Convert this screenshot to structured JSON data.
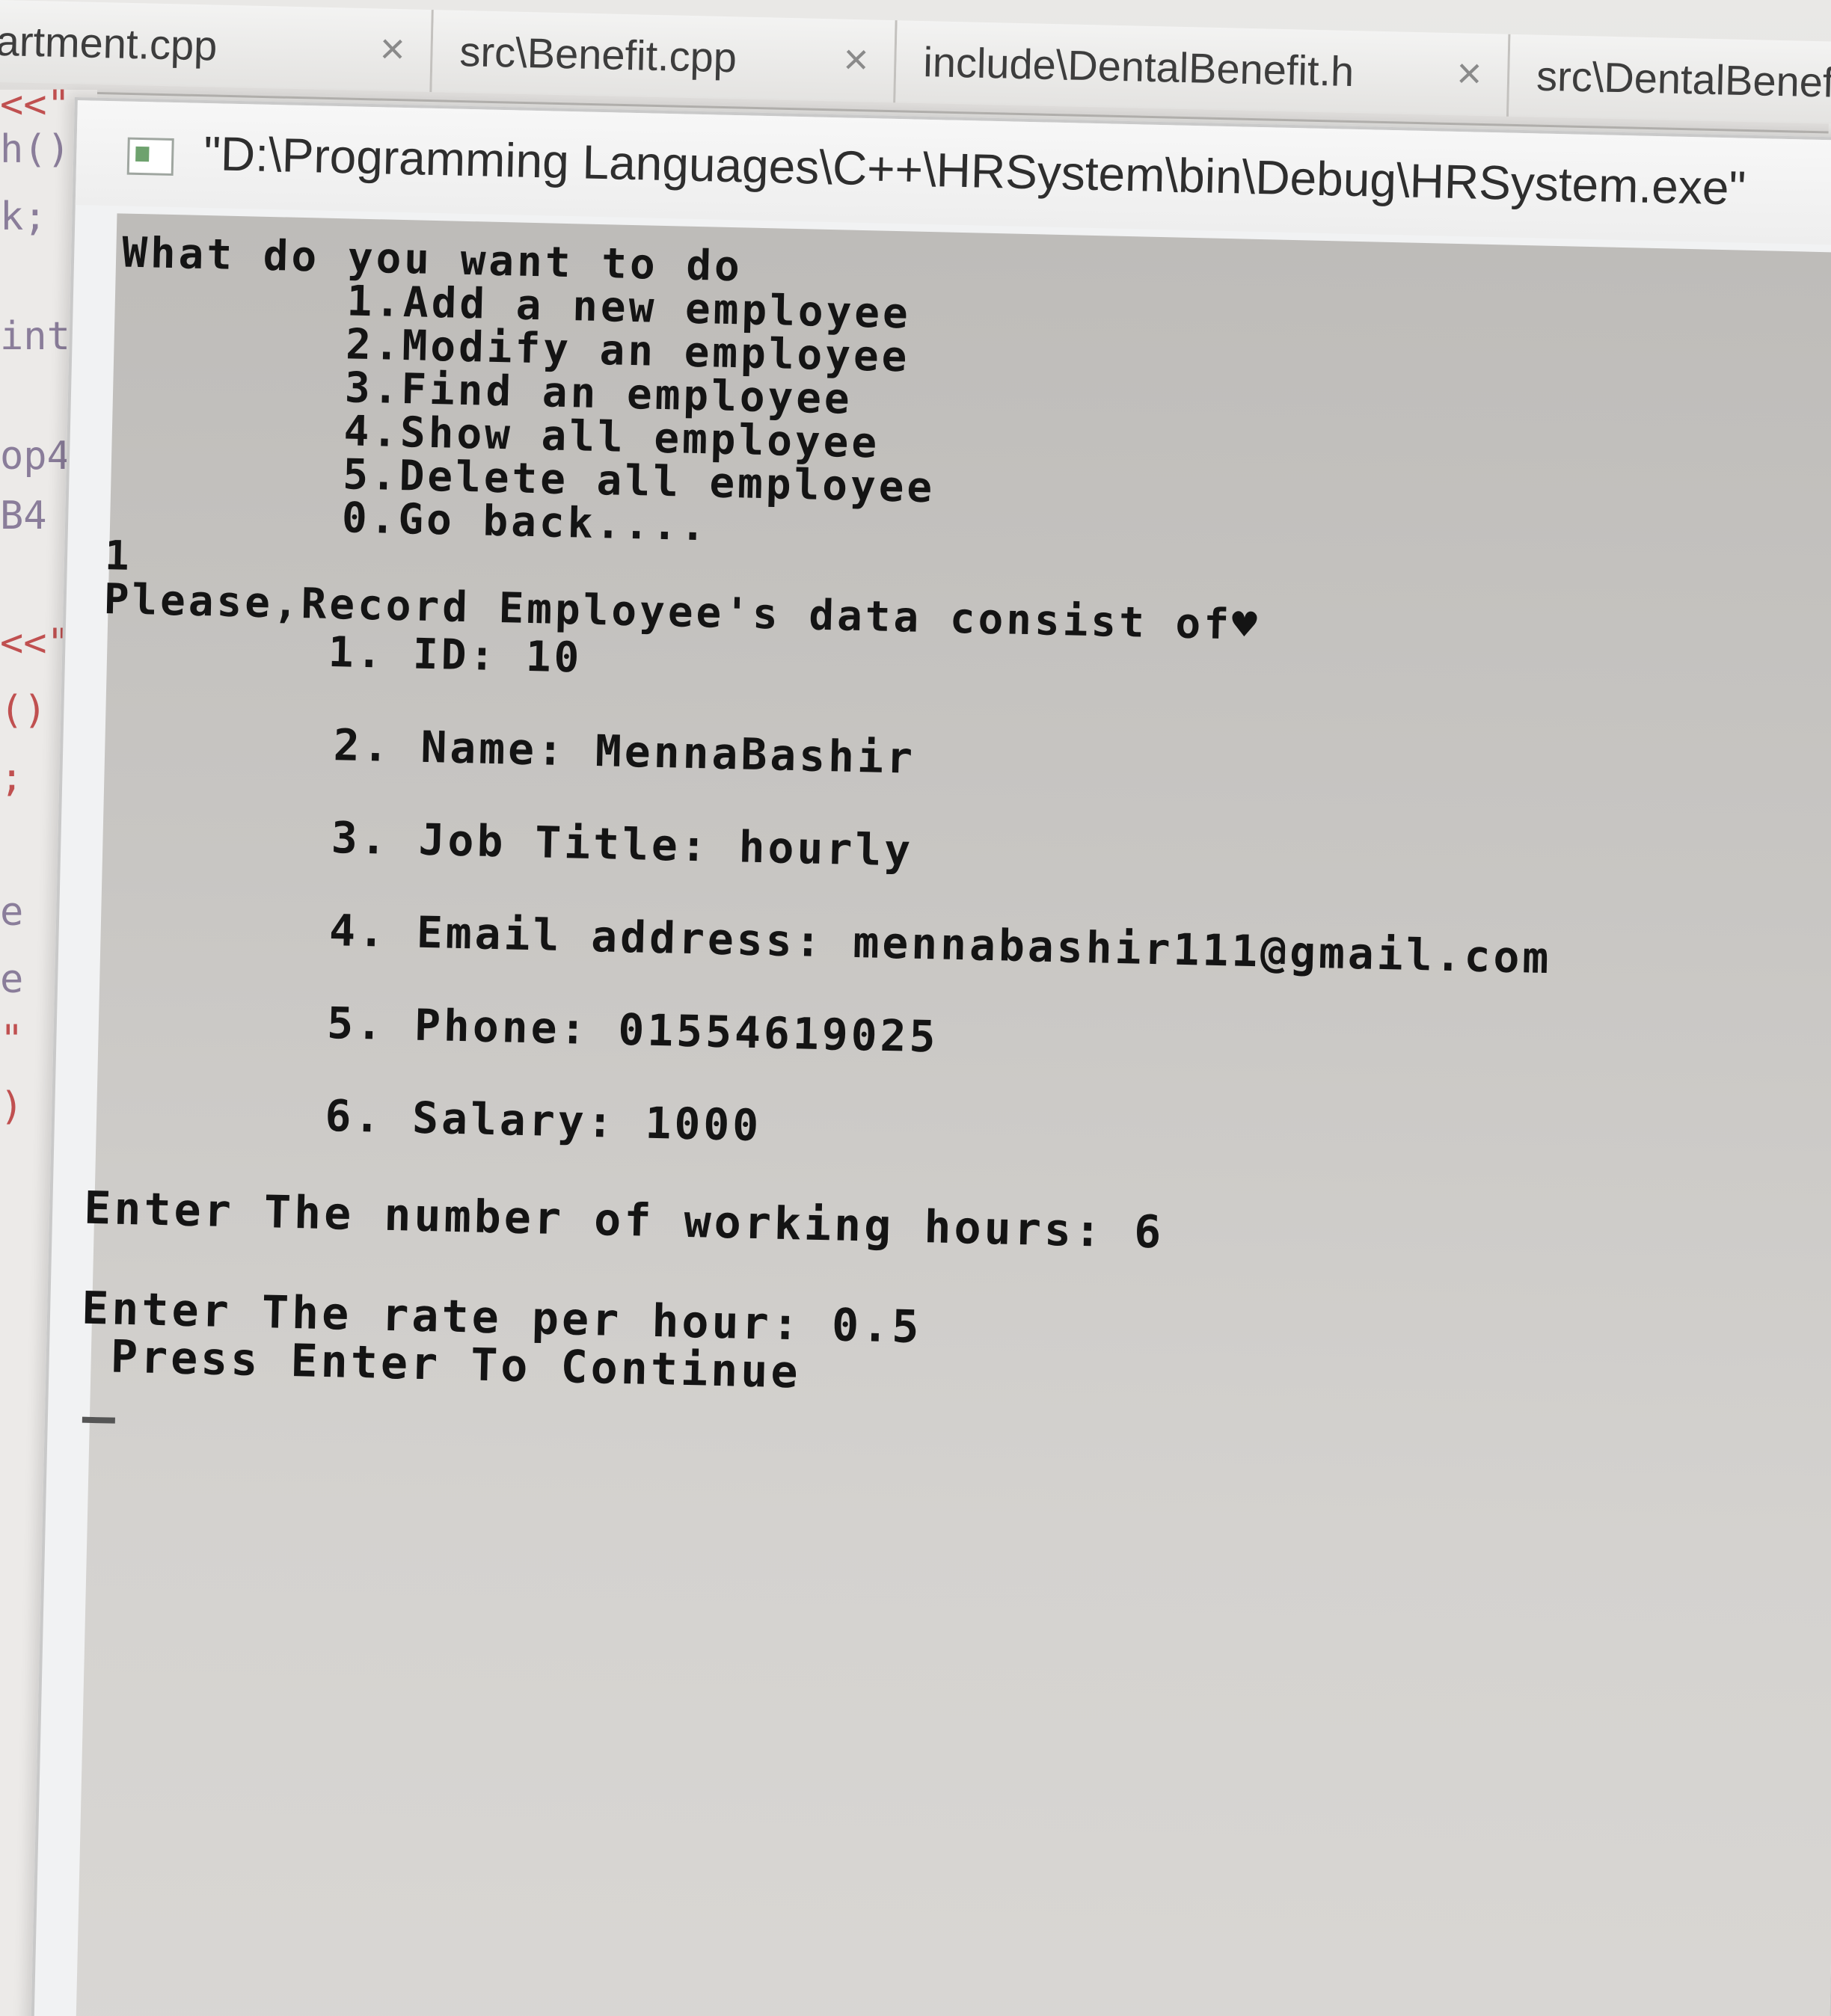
{
  "ide": {
    "tabs": [
      {
        "label": "artment.cpp",
        "close": "×"
      },
      {
        "label": "src\\Benefit.cpp",
        "close": "×"
      },
      {
        "label": "include\\DentalBenefit.h",
        "close": "×"
      },
      {
        "label": "src\\DentalBenefit.",
        "close": ""
      }
    ],
    "code_fragments": [
      "<<\"",
      "h()",
      "k;",
      "int",
      "op4",
      "B4",
      "<<\"",
      "()",
      ";",
      "e",
      "e",
      "\"",
      ")"
    ]
  },
  "console": {
    "title": "\"D:\\Programming Languages\\C++\\HRSystem\\bin\\Debug\\HRSystem.exe\"",
    "lines": [
      "What do you want to do",
      "        1.Add a new employee",
      "        2.Modify an employee",
      "        3.Find an employee",
      "        4.Show all employee",
      "        5.Delete all employee",
      "        0.Go back....",
      "1",
      "Please,Record Employee's data consist of♥",
      "        1. ID: 10",
      "        2. Name: MennaBashir",
      "        3. Job Title: hourly",
      "        4. Email address: mennabashir111@gmail.com",
      "        5. Phone: 01554619025",
      "        6. Salary: 1000",
      "Enter The number of working hours: 6",
      "Enter The rate per hour: 0.5",
      " Press Enter To Continue"
    ],
    "cursor": "_"
  }
}
